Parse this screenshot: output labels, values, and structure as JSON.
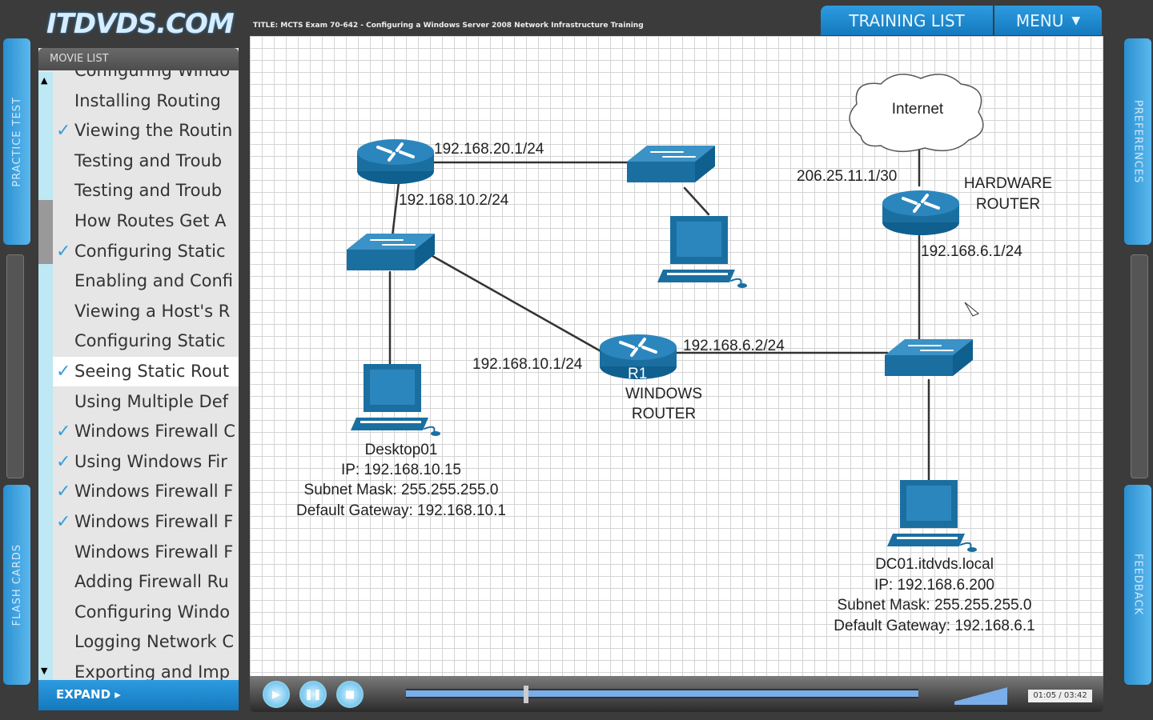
{
  "app": {
    "logo": "ITDVDS.COM",
    "title": "TITLE: MCTS Exam 70-642 - Configuring a Windows Server 2008 Network Infrastructure Training"
  },
  "nav": {
    "training_list": "TRAINING LIST",
    "menu": "MENU",
    "menu_arrow": "▼"
  },
  "side_tabs": {
    "practice_test": "PRACTICE TEST",
    "flash_cards": "FLASH CARDS",
    "preferences": "PREFERENCES",
    "feedback": "FEEDBACK"
  },
  "movie_list": {
    "header": "MOVIE LIST",
    "expand": "EXPAND ▸",
    "scroll_up": "▲",
    "scroll_down": "▼",
    "items": [
      {
        "label": "Configuring Windo",
        "checked": false
      },
      {
        "label": "Installing Routing",
        "checked": false
      },
      {
        "label": "Viewing the Routin",
        "checked": true
      },
      {
        "label": "Testing and Troub",
        "checked": false
      },
      {
        "label": "Testing and Troub",
        "checked": false
      },
      {
        "label": "How Routes Get A",
        "checked": false
      },
      {
        "label": "Configuring Static",
        "checked": true
      },
      {
        "label": "Enabling and Confi",
        "checked": false
      },
      {
        "label": "Viewing a Host's R",
        "checked": false
      },
      {
        "label": "Configuring Static",
        "checked": false
      },
      {
        "label": "Seeing Static Rout",
        "checked": true,
        "selected": true
      },
      {
        "label": "Using Multiple Def",
        "checked": false
      },
      {
        "label": "Windows Firewall C",
        "checked": true
      },
      {
        "label": "Using Windows Fir",
        "checked": true
      },
      {
        "label": "Windows Firewall F",
        "checked": true
      },
      {
        "label": "Windows Firewall F",
        "checked": true
      },
      {
        "label": "Windows Firewall F",
        "checked": false
      },
      {
        "label": "Adding Firewall Ru",
        "checked": false
      },
      {
        "label": "Configuring Windo",
        "checked": false
      },
      {
        "label": "Logging Network C",
        "checked": false
      },
      {
        "label": "Exporting and Imp",
        "checked": false
      }
    ]
  },
  "diagram": {
    "internet": "Internet",
    "r_top_ip1": "192.168.20.1/24",
    "r_top_ip2": "192.168.10.2/24",
    "wan_ip": "206.25.11.1/30",
    "hw_router": [
      "HARDWARE",
      "ROUTER"
    ],
    "hw_lan_ip": "192.168.6.1/24",
    "r1_left_ip": "192.168.10.1/24",
    "r1_right_ip": "192.168.6.2/24",
    "r1_label": "R1",
    "win_router": [
      "WINDOWS",
      "ROUTER"
    ],
    "desktop": [
      "Desktop01",
      "IP: 192.168.10.15",
      "Subnet Mask: 255.255.255.0",
      "Default Gateway: 192.168.10.1"
    ],
    "dc": [
      "DC01.itdvds.local",
      "IP: 192.168.6.200",
      "Subnet Mask: 255.255.255.0",
      "Default Gateway: 192.168.6.1"
    ],
    "device_color": "#1a6fa0"
  },
  "player": {
    "time": "01:05 / 03:42",
    "progress": 0.23,
    "volume": 0.8
  }
}
